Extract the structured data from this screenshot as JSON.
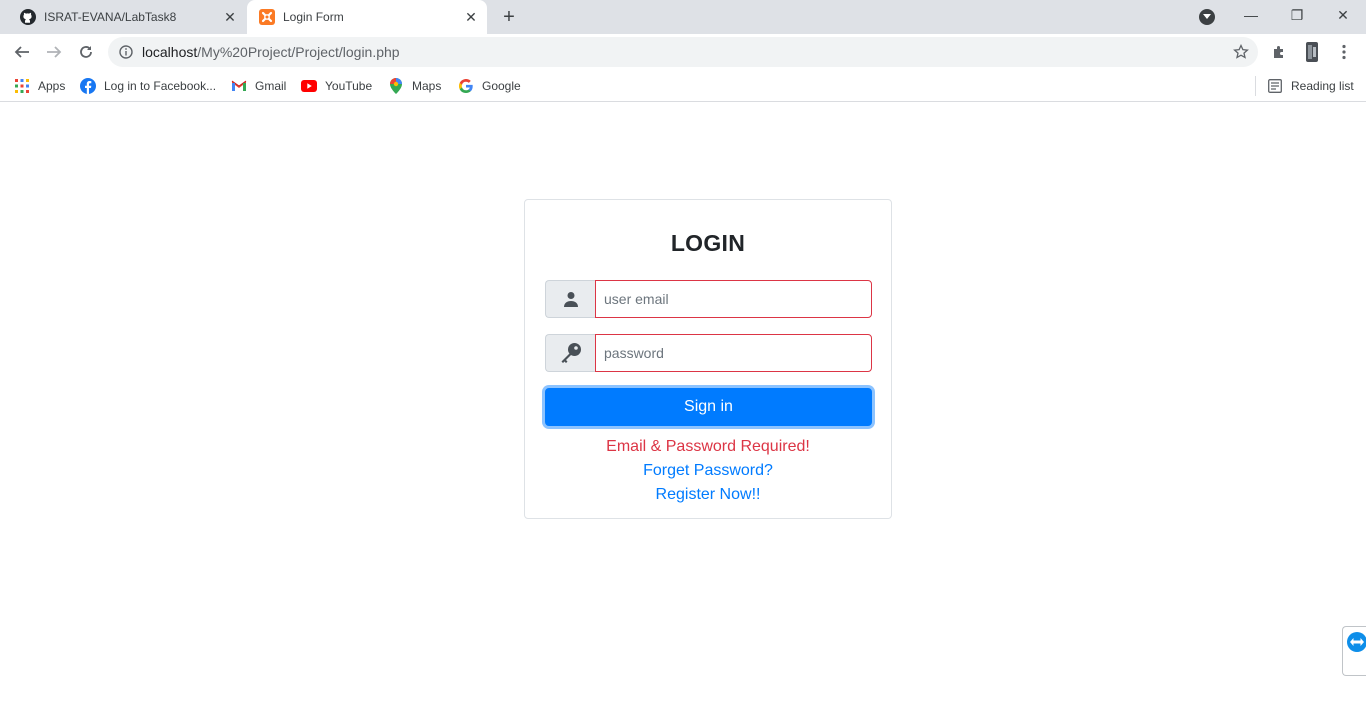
{
  "browser": {
    "tabs": [
      {
        "title": "ISRAT-EVANA/LabTask8",
        "icon": "github-icon",
        "active": false
      },
      {
        "title": "Login Form",
        "icon": "xampp-icon",
        "active": true
      }
    ],
    "close_glyph": "✕",
    "new_tab_glyph": "+",
    "window_controls": {
      "minimize": "—",
      "maximize": "❐",
      "close": "✕"
    },
    "address_bar": {
      "host": "localhost",
      "path": "/My%20Project/Project/login.php"
    },
    "bookmarks": [
      {
        "label": "Apps",
        "icon": "apps-grid-icon"
      },
      {
        "label": "Log in to Facebook...",
        "icon": "facebook-icon"
      },
      {
        "label": "Gmail",
        "icon": "gmail-icon"
      },
      {
        "label": "YouTube",
        "icon": "youtube-icon"
      },
      {
        "label": "Maps",
        "icon": "maps-icon"
      },
      {
        "label": "Google",
        "icon": "google-icon"
      }
    ],
    "reading_list_label": "Reading list"
  },
  "login": {
    "title": "LOGIN",
    "email_placeholder": "user email",
    "password_placeholder": "password",
    "signin_label": "Sign in",
    "error_message": "Email & Password Required!",
    "forget_link": "Forget Password?",
    "register_link": "Register Now!!"
  },
  "colors": {
    "primary": "#007bff",
    "danger": "#dc3545",
    "tab_strip": "#dee1e6"
  }
}
